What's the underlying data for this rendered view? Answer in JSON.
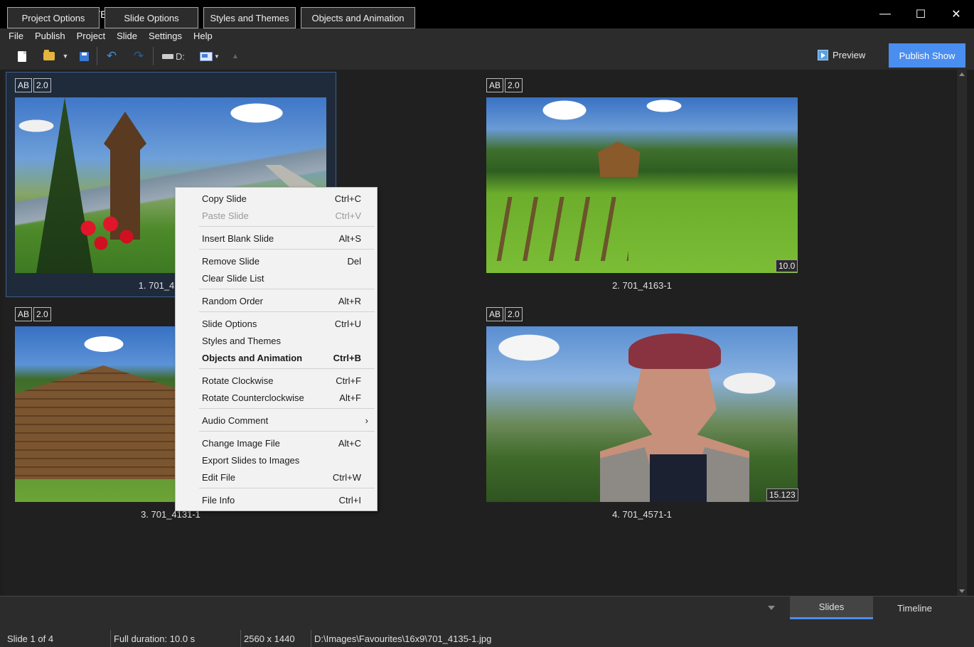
{
  "window": {
    "title": "OH Images - PTE AV Studio Pro",
    "controls": {
      "minimize": "—",
      "maximize": "☐",
      "close": "✕"
    }
  },
  "menu": [
    "File",
    "Publish",
    "Project",
    "Slide",
    "Settings",
    "Help"
  ],
  "toolbar": {
    "icons": [
      "new-document-icon",
      "open-folder-icon",
      "dropdown-arrow-icon",
      "save-icon",
      "undo-icon",
      "redo-icon",
      "drive-icon",
      "view-mode-icon",
      "up-arrow-icon"
    ],
    "drive_label": "D:",
    "preview_label": "Preview",
    "publish_label": "Publish Show",
    "accent": "#4a8ef0"
  },
  "slides": [
    {
      "label": "1. 701_4",
      "badges": [
        "AB",
        "2.0"
      ],
      "duration": "",
      "selected": true
    },
    {
      "label": "2. 701_4163-1",
      "badges": [
        "AB",
        "2.0"
      ],
      "duration": "10.0"
    },
    {
      "label": "3. 701_4131-1",
      "badges": [
        "AB",
        "2.0"
      ],
      "duration": ""
    },
    {
      "label": "4. 701_4571-1",
      "badges": [
        "AB",
        "2.0"
      ],
      "duration": "15.123"
    }
  ],
  "context_menu": [
    {
      "label": "Copy Slide",
      "shortcut": "Ctrl+C"
    },
    {
      "label": "Paste Slide",
      "shortcut": "Ctrl+V",
      "disabled": true
    },
    {
      "label": "Insert Blank Slide",
      "shortcut": "Alt+S"
    },
    {
      "label": "Remove Slide",
      "shortcut": "Del"
    },
    {
      "label": "Clear Slide List",
      "shortcut": ""
    },
    {
      "label": "Random Order",
      "shortcut": "Alt+R"
    },
    {
      "label": "Slide Options",
      "shortcut": "Ctrl+U"
    },
    {
      "label": "Styles and Themes",
      "shortcut": ""
    },
    {
      "label": "Objects and Animation",
      "shortcut": "Ctrl+B",
      "bold": true
    },
    {
      "label": "Rotate Clockwise",
      "shortcut": "Ctrl+F"
    },
    {
      "label": "Rotate Counterclockwise",
      "shortcut": "Alt+F"
    },
    {
      "label": "Audio Comment",
      "shortcut": "›"
    },
    {
      "label": "Change Image File",
      "shortcut": "Alt+C"
    },
    {
      "label": "Export Slides to Images",
      "shortcut": ""
    },
    {
      "label": "Edit File",
      "shortcut": "Ctrl+W"
    },
    {
      "label": "File Info",
      "shortcut": "Ctrl+I"
    }
  ],
  "bottom": {
    "buttons": [
      "Project Options",
      "Slide Options",
      "Styles and Themes",
      "Objects and Animation"
    ],
    "tabs": [
      "Slides",
      "Timeline"
    ]
  },
  "status": {
    "slide": "Slide 1 of 4",
    "duration": "Full duration: 10.0 s",
    "resolution": "2560 x 1440",
    "path": "D:\\Images\\Favourites\\16x9\\701_4135-1.jpg"
  }
}
